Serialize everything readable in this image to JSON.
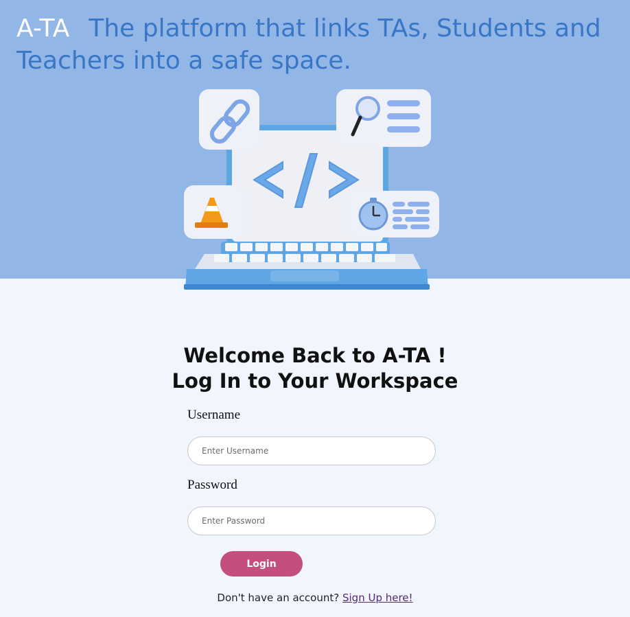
{
  "header": {
    "brand": "A-TA",
    "tagline": "The platform that links TAs, Students and Teachers into a safe space."
  },
  "illustration": {
    "icons": [
      "link-icon",
      "magnifier-icon",
      "code-icon",
      "traffic-cone-icon",
      "stopwatch-icon",
      "keyboard-icon"
    ]
  },
  "form": {
    "title_line1": "Welcome Back to A-TA !",
    "title_line2": "Log In to Your Workspace",
    "username_label": "Username",
    "username_placeholder": "Enter Username",
    "username_value": "",
    "password_label": "Password",
    "password_placeholder": "Enter Password",
    "password_value": "",
    "login_label": "Login",
    "signup_prompt": "Don't have an account?",
    "signup_link": "Sign Up here!"
  },
  "colors": {
    "hero_background": "#92b6e6",
    "page_background": "#f1f5fd",
    "tagline": "#3a76c6",
    "brand": "#ffffff",
    "login_button": "#c44f7e",
    "signup_link": "#55267a"
  }
}
